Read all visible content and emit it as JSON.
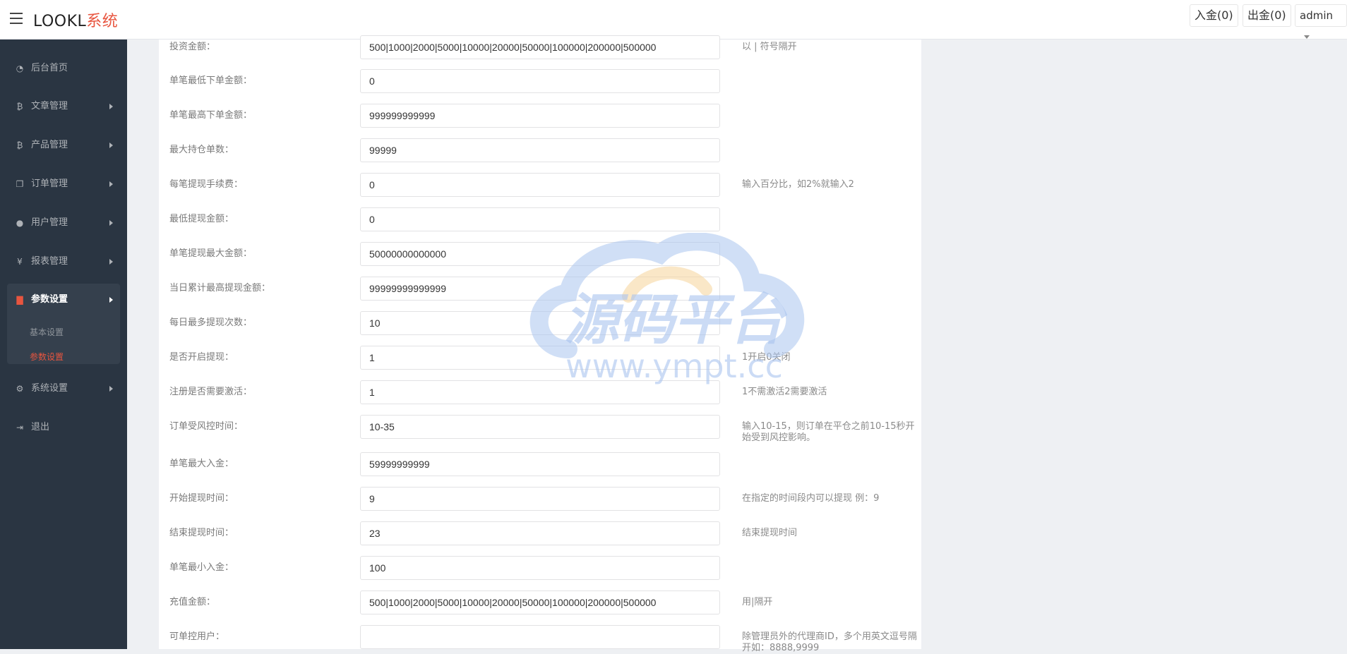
{
  "header": {
    "brand_main": "LOOKL",
    "brand_accent": "系统",
    "deposit_button": "入金(0)",
    "withdraw_button": "出金(0)",
    "user_name": "admin"
  },
  "sidebar": {
    "items": [
      {
        "label": "后台首页",
        "icon": "dashboard-icon"
      },
      {
        "label": "文章管理",
        "icon": "bitcoin-icon"
      },
      {
        "label": "产品管理",
        "icon": "bitcoin-icon"
      },
      {
        "label": "订单管理",
        "icon": "copy-icon"
      },
      {
        "label": "用户管理",
        "icon": "user-icon"
      },
      {
        "label": "报表管理",
        "icon": "yen-icon"
      },
      {
        "label": "参数设置",
        "icon": "files-icon"
      },
      {
        "label": "系统设置",
        "icon": "cogs-icon"
      },
      {
        "label": "退出",
        "icon": "sign-out-icon"
      }
    ],
    "sub_items": [
      {
        "label": "基本设置"
      },
      {
        "label": "参数设置"
      }
    ]
  },
  "form": {
    "rows": [
      {
        "label": "投资金额：",
        "value": "500|1000|2000|5000|10000|20000|50000|100000|200000|500000",
        "hint": "以 | 符号隔开"
      },
      {
        "label": "单笔最低下单金额：",
        "value": "0",
        "hint": ""
      },
      {
        "label": "单笔最高下单金额：",
        "value": "999999999999",
        "hint": ""
      },
      {
        "label": "最大持仓单数：",
        "value": "99999",
        "hint": ""
      },
      {
        "label": "每笔提现手续费：",
        "value": "0",
        "hint": "输入百分比，如2%就输入2"
      },
      {
        "label": "最低提现金额：",
        "value": "0",
        "hint": ""
      },
      {
        "label": "单笔提现最大金额：",
        "value": "50000000000000",
        "hint": ""
      },
      {
        "label": "当日累计最高提现金额：",
        "value": "99999999999999",
        "hint": ""
      },
      {
        "label": "每日最多提现次数：",
        "value": "10",
        "hint": ""
      },
      {
        "label": "是否开启提现：",
        "value": "1",
        "hint": "1开启0关闭"
      },
      {
        "label": "注册是否需要激活：",
        "value": "1",
        "hint": "1不需激活2需要激活"
      },
      {
        "label": "订单受风控时间：",
        "value": "10-35",
        "hint": "输入10-15，则订单在平仓之前10-15秒开始受到风控影响。"
      },
      {
        "label": "单笔最大入金：",
        "value": "59999999999",
        "hint": ""
      },
      {
        "label": "开始提现时间：",
        "value": "9",
        "hint": "在指定的时间段内可以提现 例：9"
      },
      {
        "label": "结束提现时间：",
        "value": "23",
        "hint": "结束提现时间"
      },
      {
        "label": "单笔最小入金：",
        "value": "100",
        "hint": ""
      },
      {
        "label": "充值金额：",
        "value": "500|1000|2000|5000|10000|20000|50000|100000|200000|500000",
        "hint": "用|隔开"
      },
      {
        "label": "可单控用户：",
        "value": "",
        "hint": "除管理员外的代理商ID，多个用英文逗号隔开如：8888,9999"
      }
    ]
  },
  "watermark": {
    "text": "源码平台",
    "url": "www.ympt.cc"
  },
  "colors": {
    "sidebar_bg": "#2a3542",
    "accent": "#e8553f",
    "watermark_blue": "#a9c4ef",
    "watermark_orange": "#f7d7a1"
  }
}
